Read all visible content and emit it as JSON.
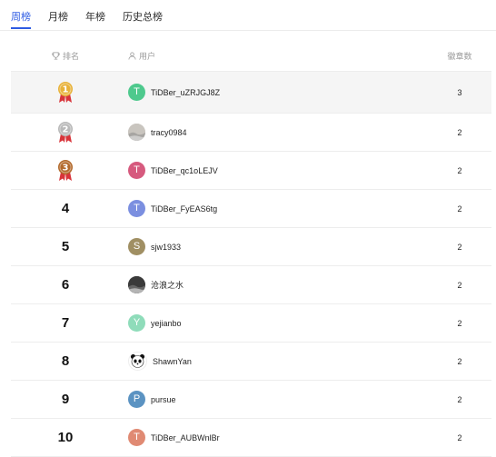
{
  "tabs": [
    {
      "label": "周榜",
      "active": true
    },
    {
      "label": "月榜",
      "active": false
    },
    {
      "label": "年榜",
      "active": false
    },
    {
      "label": "历史总榜",
      "active": false
    }
  ],
  "table": {
    "headers": {
      "rank": "排名",
      "user": "用户",
      "count": "徽章数"
    },
    "rows": [
      {
        "rank": "1",
        "medal": "gold",
        "avatar_letter": "T",
        "avatar_color": "#4ec98d",
        "avatar_type": "letter",
        "username": "TiDBer_uZRJGJ8Z",
        "count": "3"
      },
      {
        "rank": "2",
        "medal": "silver",
        "avatar_letter": "",
        "avatar_color": "#c9c5bf",
        "avatar_type": "photo",
        "username": "tracy0984",
        "count": "2"
      },
      {
        "rank": "3",
        "medal": "bronze",
        "avatar_letter": "T",
        "avatar_color": "#d65a7e",
        "avatar_type": "letter",
        "username": "TiDBer_qc1oLEJV",
        "count": "2"
      },
      {
        "rank": "4",
        "medal": "",
        "avatar_letter": "T",
        "avatar_color": "#7b8fe0",
        "avatar_type": "letter",
        "username": "TiDBer_FyEAS6tg",
        "count": "2"
      },
      {
        "rank": "5",
        "medal": "",
        "avatar_letter": "S",
        "avatar_color": "#a08f63",
        "avatar_type": "letter",
        "username": "sjw1933",
        "count": "2"
      },
      {
        "rank": "6",
        "medal": "",
        "avatar_letter": "",
        "avatar_color": "#3a3a3a",
        "avatar_type": "photo",
        "username": "沧浪之水",
        "count": "2"
      },
      {
        "rank": "7",
        "medal": "",
        "avatar_letter": "Y",
        "avatar_color": "#8fdcba",
        "avatar_type": "letter",
        "username": "yejianbo",
        "count": "2"
      },
      {
        "rank": "8",
        "medal": "",
        "avatar_letter": "",
        "avatar_color": "#ffffff",
        "avatar_type": "panda",
        "username": "ShawnYan",
        "count": "2"
      },
      {
        "rank": "9",
        "medal": "",
        "avatar_letter": "P",
        "avatar_color": "#5b93c2",
        "avatar_type": "letter",
        "username": "pursue",
        "count": "2"
      },
      {
        "rank": "10",
        "medal": "",
        "avatar_letter": "T",
        "avatar_color": "#e08a73",
        "avatar_type": "letter",
        "username": "TiDBer_AUBWnlBr",
        "count": "2"
      }
    ]
  },
  "colors": {
    "accent": "#2d5be3",
    "gold": "#e8b23a",
    "silver": "#b9b9b9",
    "bronze": "#b36a2c",
    "ribbon": "#d8343a"
  }
}
